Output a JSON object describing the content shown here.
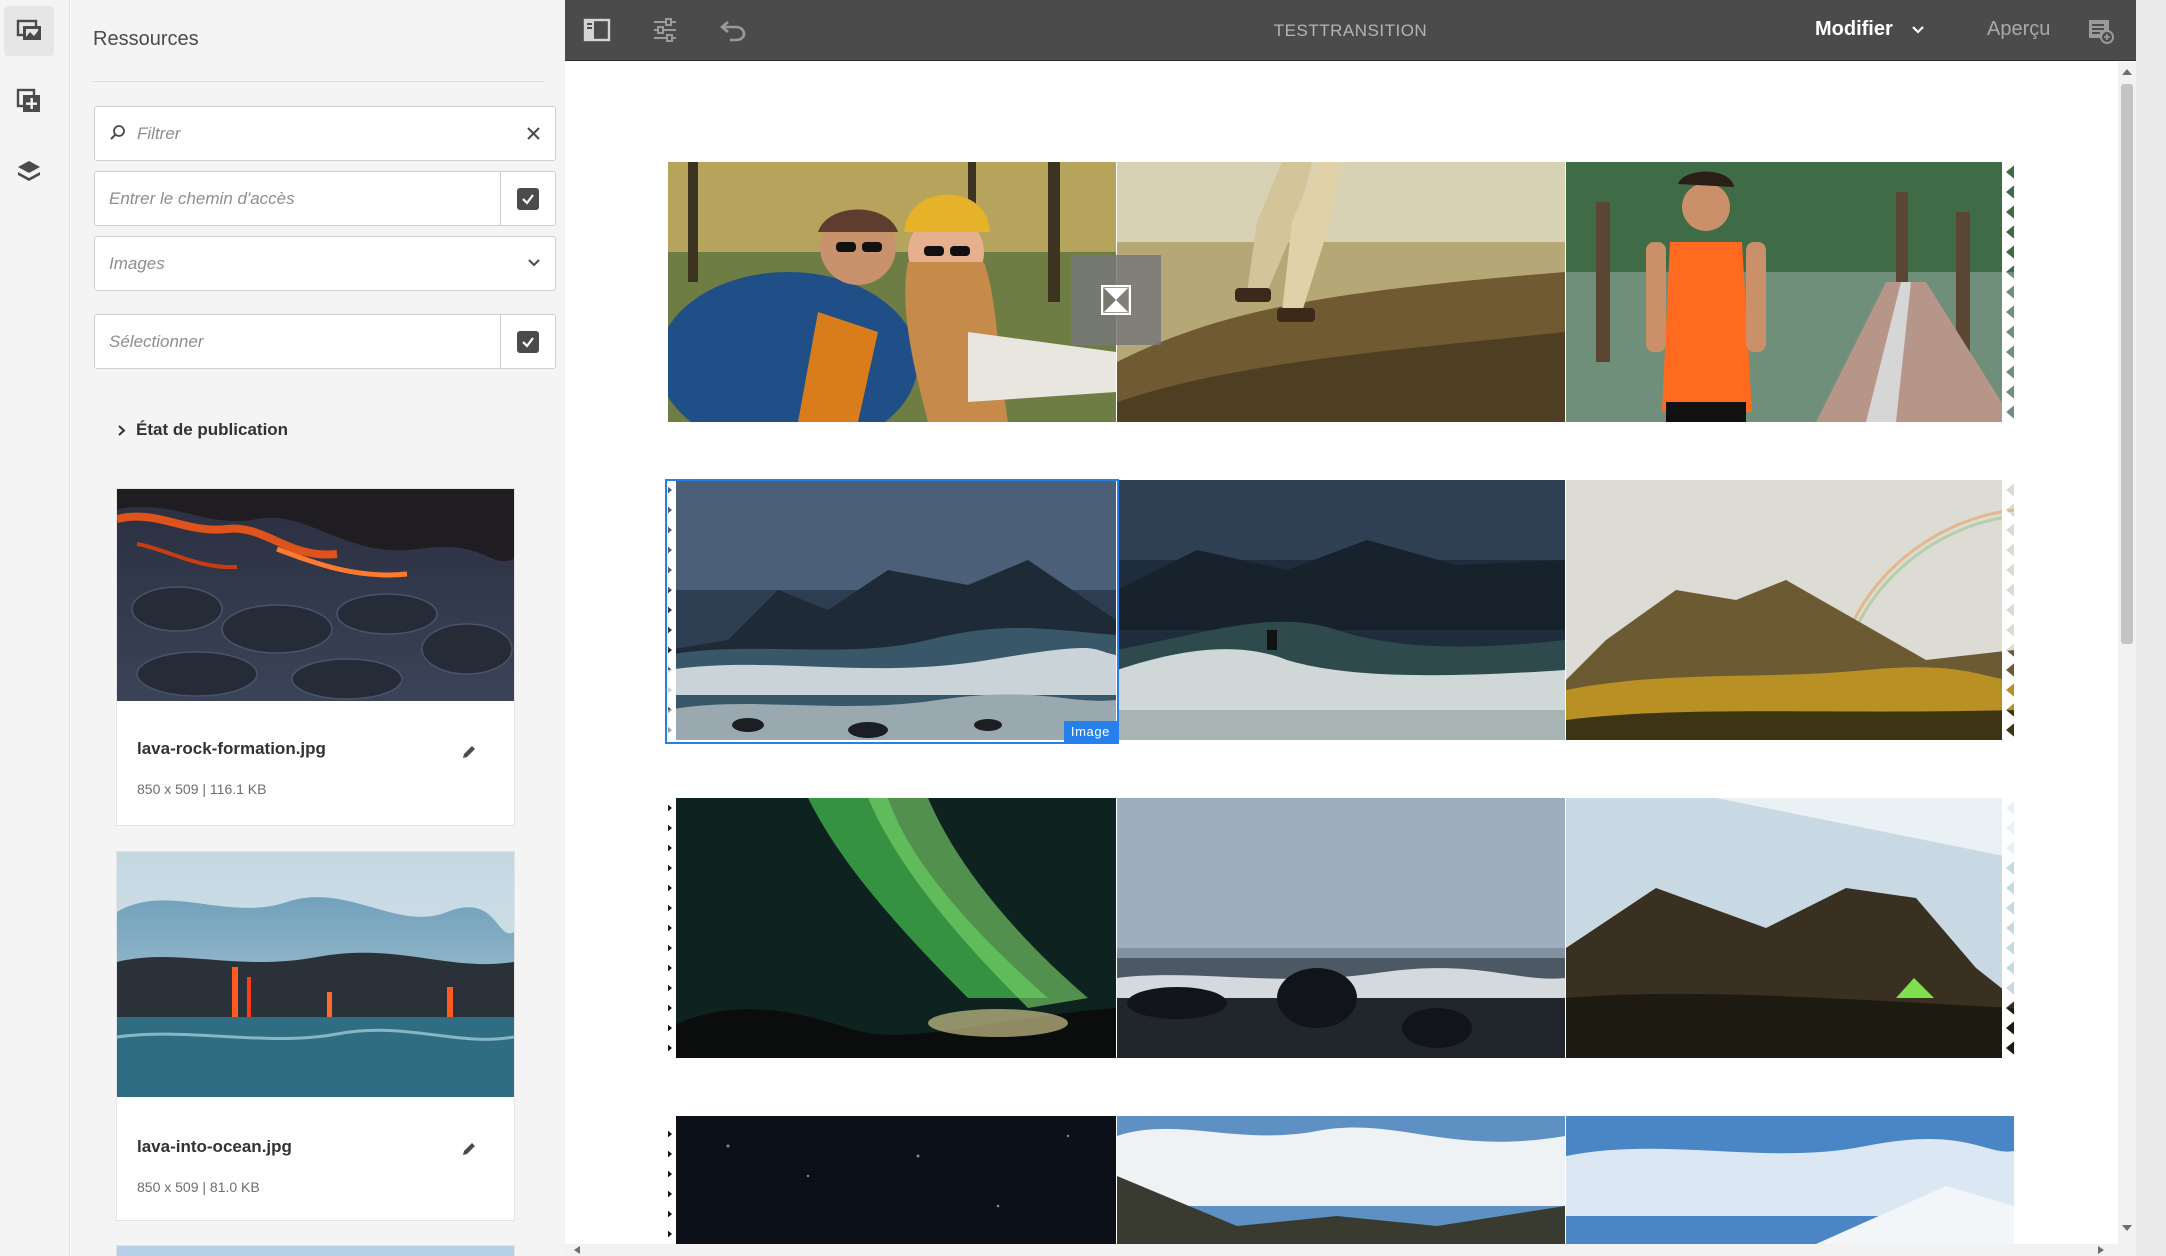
{
  "rail": {
    "items": [
      {
        "name": "assets-panel-icon",
        "active": true
      },
      {
        "name": "components-panel-icon",
        "active": false
      },
      {
        "name": "content-tree-icon",
        "active": false
      }
    ]
  },
  "panel": {
    "title": "Ressources",
    "filter_placeholder": "Filtrer",
    "path_placeholder": "Entrer le chemin d'accès",
    "type_value": "Images",
    "select_placeholder": "Sélectionner",
    "publication_label": "État de publication",
    "assets": [
      {
        "name": "lava-rock-formation.jpg",
        "meta": "850 x 509 | 116.1 KB"
      },
      {
        "name": "lava-into-ocean.jpg",
        "meta": "850 x 509 | 81.0 KB"
      }
    ]
  },
  "toolbar": {
    "page_title": "TESTTRANSITION",
    "mode_label": "Modifier",
    "preview_label": "Aperçu"
  },
  "canvas": {
    "selected_component_label": "Image"
  },
  "colors": {
    "accent": "#2680eb",
    "toolbar_bg": "#4b4b4b",
    "panel_bg": "#f4f4f4"
  }
}
